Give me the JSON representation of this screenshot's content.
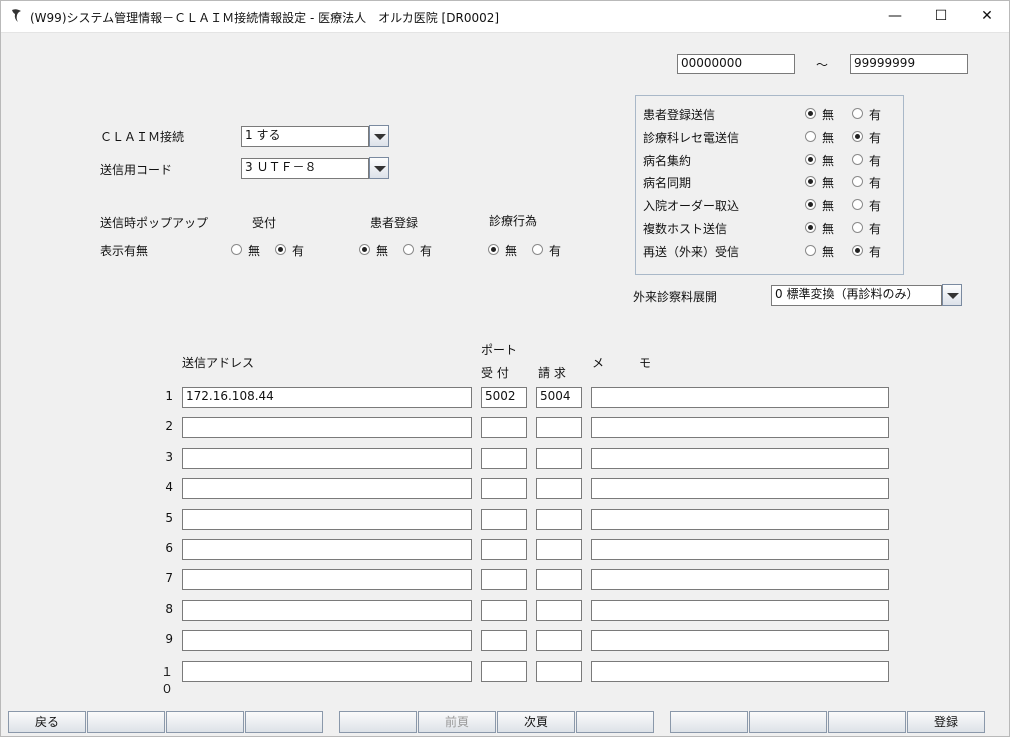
{
  "window": {
    "title": "(W99)システム管理情報－ＣＬＡＩＭ接続情報設定 - 医療法人　オルカ医院 [DR0002]",
    "minimize": "—",
    "maximize": "☐",
    "close": "✕"
  },
  "range": {
    "from": "00000000",
    "sep": "～",
    "to": "99999999"
  },
  "claim": {
    "connect_label": "ＣＬＡＩＭ接続",
    "connect_value": "1 する",
    "code_label": "送信用コード",
    "code_value": "3 ＵＴＦ－８"
  },
  "popup": {
    "label1": "送信時ポップアップ",
    "label2": "表示有無",
    "groups": [
      {
        "title": "受付",
        "selected": "有"
      },
      {
        "title": "患者登録",
        "selected": "無"
      },
      {
        "title": "診療行為",
        "selected": "無"
      }
    ],
    "opt_no": "無",
    "opt_yes": "有"
  },
  "options": [
    {
      "label": "患者登録送信",
      "selected": "無"
    },
    {
      "label": "診療科レセ電送信",
      "selected": "有"
    },
    {
      "label": "病名集約",
      "selected": "無"
    },
    {
      "label": "病名同期",
      "selected": "無"
    },
    {
      "label": "入院オーダー取込",
      "selected": "無"
    },
    {
      "label": "複数ホスト送信",
      "selected": "無"
    },
    {
      "label": "再送（外来）受信",
      "selected": "有"
    }
  ],
  "outpatient": {
    "label": "外来診察料展開",
    "value": "0 標準変換（再診料のみ）"
  },
  "table": {
    "h_address": "送信アドレス",
    "h_port": "ポート",
    "h_recv": "受 付",
    "h_bill": "請 求",
    "h_memo1": "メ",
    "h_memo2": "モ",
    "rows": [
      {
        "no": "1",
        "address": "172.16.108.44",
        "recv": "5002",
        "bill": "5004",
        "memo": ""
      },
      {
        "no": "2",
        "address": "",
        "recv": "",
        "bill": "",
        "memo": ""
      },
      {
        "no": "3",
        "address": "",
        "recv": "",
        "bill": "",
        "memo": ""
      },
      {
        "no": "4",
        "address": "",
        "recv": "",
        "bill": "",
        "memo": ""
      },
      {
        "no": "5",
        "address": "",
        "recv": "",
        "bill": "",
        "memo": ""
      },
      {
        "no": "6",
        "address": "",
        "recv": "",
        "bill": "",
        "memo": ""
      },
      {
        "no": "7",
        "address": "",
        "recv": "",
        "bill": "",
        "memo": ""
      },
      {
        "no": "8",
        "address": "",
        "recv": "",
        "bill": "",
        "memo": ""
      },
      {
        "no": "9",
        "address": "",
        "recv": "",
        "bill": "",
        "memo": ""
      },
      {
        "no": "１０",
        "address": "",
        "recv": "",
        "bill": "",
        "memo": ""
      }
    ]
  },
  "fkeys": [
    {
      "label": "戻る",
      "enabled": true
    },
    {
      "label": "",
      "enabled": true
    },
    {
      "label": "",
      "enabled": true
    },
    {
      "label": "",
      "enabled": true
    },
    {
      "label": "",
      "enabled": true
    },
    {
      "label": "前頁",
      "enabled": false
    },
    {
      "label": "次頁",
      "enabled": true
    },
    {
      "label": "",
      "enabled": true
    },
    {
      "label": "",
      "enabled": true
    },
    {
      "label": "",
      "enabled": true
    },
    {
      "label": "",
      "enabled": true
    },
    {
      "label": "登録",
      "enabled": true
    }
  ]
}
